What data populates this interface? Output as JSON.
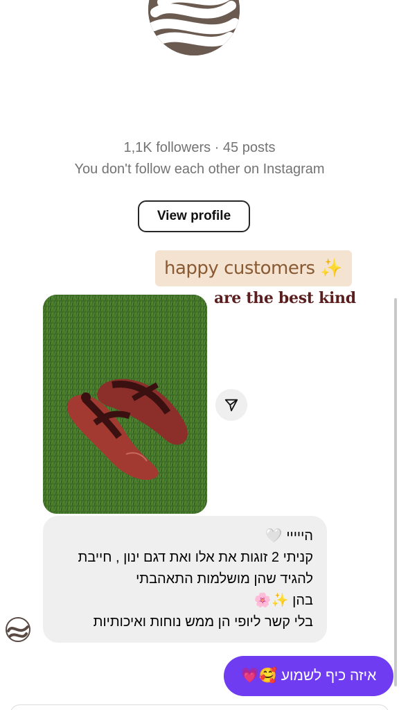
{
  "profile": {
    "followers_line": "1,1K followers · 45 posts",
    "follow_note": "You don't follow each other on Instagram",
    "view_profile_label": "View profile"
  },
  "story": {
    "sticker_line_1": "happy customers ✨",
    "sticker_line_2": "are the best kind"
  },
  "messages": {
    "received": {
      "line_1": "הייייי 🤍",
      "line_2": "קניתי 2 זוגות את אלו ואת דגם ינון , חייבת",
      "line_3": "להגיד שהן מושלמות התאהבתי",
      "line_4": "בהן ✨🌸",
      "line_5": "בלי קשר ליופי הן ממש נוחות ואיכותיות"
    },
    "sent": {
      "text": "איזה כיף לשמוע 🥰💗"
    }
  },
  "icons": {
    "share": "paper-plane-icon",
    "avatar": "profile-avatar"
  },
  "colors": {
    "sent_bubble": "#6f3cf2",
    "received_bubble": "#efefef",
    "muted_text": "#737373",
    "sticker_bg": "#f4e3d1",
    "sticker_text": "#8a5a33",
    "headline_text": "#5a1e1e"
  }
}
